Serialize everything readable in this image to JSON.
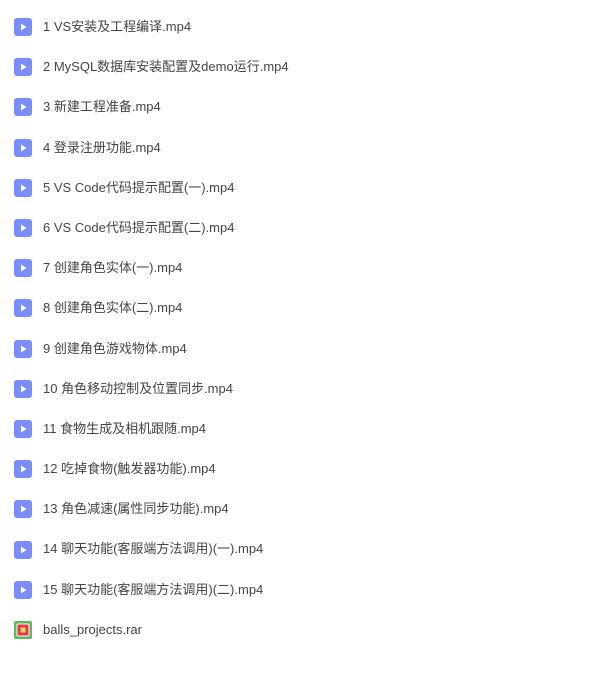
{
  "files": [
    {
      "name": "1 VS安装及工程编译.mp4",
      "type": "video"
    },
    {
      "name": "2 MySQL数据库安装配置及demo运行.mp4",
      "type": "video"
    },
    {
      "name": "3 新建工程准备.mp4",
      "type": "video"
    },
    {
      "name": "4 登录注册功能.mp4",
      "type": "video"
    },
    {
      "name": "5 VS Code代码提示配置(一).mp4",
      "type": "video"
    },
    {
      "name": "6 VS Code代码提示配置(二).mp4",
      "type": "video"
    },
    {
      "name": "7 创建角色实体(一).mp4",
      "type": "video"
    },
    {
      "name": "8 创建角色实体(二).mp4",
      "type": "video"
    },
    {
      "name": "9 创建角色游戏物体.mp4",
      "type": "video"
    },
    {
      "name": "10 角色移动控制及位置同步.mp4",
      "type": "video"
    },
    {
      "name": "11 食物生成及相机跟随.mp4",
      "type": "video"
    },
    {
      "name": "12 吃掉食物(触发器功能).mp4",
      "type": "video"
    },
    {
      "name": "13 角色减速(属性同步功能).mp4",
      "type": "video"
    },
    {
      "name": "14 聊天功能(客服端方法调用)(一).mp4",
      "type": "video"
    },
    {
      "name": "15 聊天功能(客服端方法调用)(二).mp4",
      "type": "video"
    },
    {
      "name": "balls_projects.rar",
      "type": "rar"
    }
  ],
  "icons": {
    "video": "video-icon",
    "rar": "rar-icon"
  }
}
